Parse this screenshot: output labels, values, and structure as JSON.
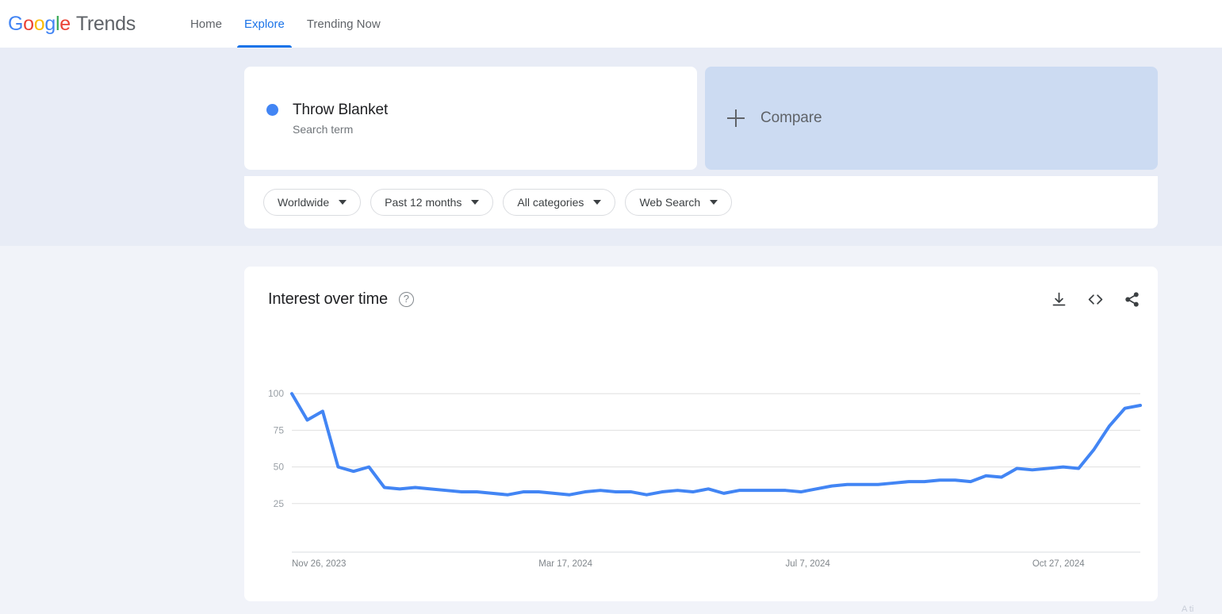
{
  "nav": {
    "brand_google": "Google",
    "brand_trends": "Trends",
    "links": [
      {
        "label": "Home",
        "active": false
      },
      {
        "label": "Explore",
        "active": true
      },
      {
        "label": "Trending Now",
        "active": false
      }
    ]
  },
  "query": {
    "term": "Throw Blanket",
    "term_type": "Search term",
    "term_color": "#4285f4",
    "compare_label": "Compare"
  },
  "filters": [
    {
      "label": "Worldwide"
    },
    {
      "label": "Past 12 months"
    },
    {
      "label": "All categories"
    },
    {
      "label": "Web Search"
    }
  ],
  "chart_panel": {
    "title": "Interest over time",
    "help_glyph": "?",
    "actions": [
      {
        "name": "download",
        "label": "Download CSV"
      },
      {
        "name": "embed",
        "label": "Embed"
      },
      {
        "name": "share",
        "label": "Share"
      }
    ]
  },
  "footer": {
    "hint": "A ti"
  },
  "chart_data": {
    "type": "line",
    "title": "Interest over time",
    "xlabel": "",
    "ylabel": "",
    "ylim": [
      0,
      105
    ],
    "grid": true,
    "gridlines": [
      100,
      75,
      50,
      25
    ],
    "ytick_labels": [
      "100",
      "75",
      "50",
      "25"
    ],
    "line_color": "#4285f4",
    "legend": [
      "Throw Blanket"
    ],
    "legend_position": "none",
    "xtick_labels": [
      "Nov 26, 2023",
      "Mar 17, 2024",
      "Jul 7, 2024",
      "Oct 27, 2024"
    ],
    "xtick_positions": [
      0,
      16,
      32,
      48
    ],
    "series": [
      {
        "name": "Throw Blanket",
        "values": [
          100,
          82,
          88,
          50,
          47,
          50,
          36,
          35,
          36,
          35,
          34,
          33,
          33,
          32,
          31,
          33,
          33,
          32,
          31,
          33,
          34,
          33,
          33,
          31,
          33,
          34,
          33,
          35,
          32,
          34,
          34,
          34,
          34,
          33,
          35,
          37,
          38,
          38,
          38,
          39,
          40,
          40,
          41,
          41,
          40,
          44,
          43,
          49,
          48,
          49,
          50,
          49,
          62,
          78,
          90,
          92
        ]
      }
    ]
  }
}
